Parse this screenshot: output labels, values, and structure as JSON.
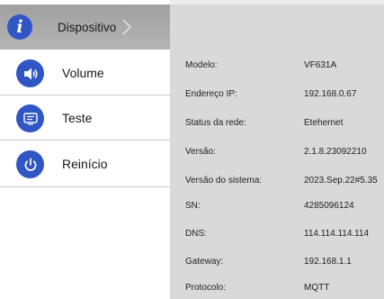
{
  "sidebar": {
    "items": [
      {
        "label": "Dispositivo",
        "icon": "info-icon",
        "active": true
      },
      {
        "label": "Volume",
        "icon": "speaker-icon",
        "active": false
      },
      {
        "label": "Teste",
        "icon": "screen-test-icon",
        "active": false
      },
      {
        "label": "Reinício",
        "icon": "power-icon",
        "active": false
      }
    ]
  },
  "device_info": {
    "rows": [
      {
        "key": "Modelo:",
        "value": "VF631A"
      },
      {
        "key": "Endereço IP:",
        "value": "192.168.0.67"
      },
      {
        "key": "Status da rede:",
        "value": "Etehernet"
      },
      {
        "key": "Versão:",
        "value": "2.1.8.23092210"
      },
      {
        "key": "Versão do sistema:",
        "value": "2023.Sep.22#5.35"
      },
      {
        "key": "SN:",
        "value": "4285096124"
      },
      {
        "key": "DNS:",
        "value": "114.114.114.114"
      },
      {
        "key": "Gateway:",
        "value": "192.168.1.1"
      },
      {
        "key": "Protocolo:",
        "value": "MQTT"
      }
    ]
  },
  "colors": {
    "accent": "#2f56c4",
    "active_item_bg": "#a8a8a8",
    "panel_bg": "#d9d9d9"
  }
}
